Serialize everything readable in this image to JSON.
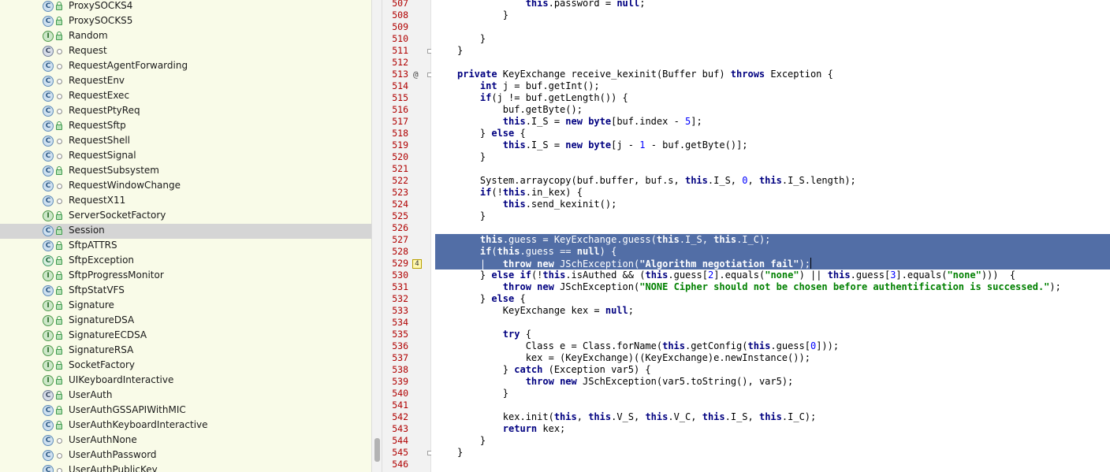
{
  "project_tree": {
    "items": [
      {
        "label": "ProxySOCKS4",
        "kind": "C",
        "vis": "lock"
      },
      {
        "label": "ProxySOCKS5",
        "kind": "C",
        "vis": "lock"
      },
      {
        "label": "Random",
        "kind": "I",
        "vis": "lock"
      },
      {
        "label": "Request",
        "kind": "A",
        "vis": "dot"
      },
      {
        "label": "RequestAgentForwarding",
        "kind": "C",
        "vis": "dot"
      },
      {
        "label": "RequestEnv",
        "kind": "C",
        "vis": "dot"
      },
      {
        "label": "RequestExec",
        "kind": "C",
        "vis": "dot"
      },
      {
        "label": "RequestPtyReq",
        "kind": "C",
        "vis": "dot"
      },
      {
        "label": "RequestSftp",
        "kind": "C",
        "vis": "lock"
      },
      {
        "label": "RequestShell",
        "kind": "C",
        "vis": "dot"
      },
      {
        "label": "RequestSignal",
        "kind": "C",
        "vis": "dot"
      },
      {
        "label": "RequestSubsystem",
        "kind": "C",
        "vis": "lock"
      },
      {
        "label": "RequestWindowChange",
        "kind": "C",
        "vis": "dot"
      },
      {
        "label": "RequestX11",
        "kind": "C",
        "vis": "dot"
      },
      {
        "label": "ServerSocketFactory",
        "kind": "I",
        "vis": "lock"
      },
      {
        "label": "Session",
        "kind": "C",
        "vis": "lock",
        "selected": true
      },
      {
        "label": "SftpATTRS",
        "kind": "C",
        "vis": "lock"
      },
      {
        "label": "SftpException",
        "kind": "E",
        "vis": "lock"
      },
      {
        "label": "SftpProgressMonitor",
        "kind": "I",
        "vis": "lock"
      },
      {
        "label": "SftpStatVFS",
        "kind": "C",
        "vis": "lock"
      },
      {
        "label": "Signature",
        "kind": "I",
        "vis": "lock"
      },
      {
        "label": "SignatureDSA",
        "kind": "I",
        "vis": "lock"
      },
      {
        "label": "SignatureECDSA",
        "kind": "I",
        "vis": "lock"
      },
      {
        "label": "SignatureRSA",
        "kind": "I",
        "vis": "lock"
      },
      {
        "label": "SocketFactory",
        "kind": "I",
        "vis": "lock"
      },
      {
        "label": "UIKeyboardInteractive",
        "kind": "I",
        "vis": "lock"
      },
      {
        "label": "UserAuth",
        "kind": "A",
        "vis": "lock"
      },
      {
        "label": "UserAuthGSSAPIWithMIC",
        "kind": "C",
        "vis": "lock"
      },
      {
        "label": "UserAuthKeyboardInteractive",
        "kind": "C",
        "vis": "lock"
      },
      {
        "label": "UserAuthNone",
        "kind": "C",
        "vis": "dot"
      },
      {
        "label": "UserAuthPassword",
        "kind": "C",
        "vis": "dot"
      },
      {
        "label": "UserAuthPublicKey",
        "kind": "C",
        "vis": "dot"
      }
    ]
  },
  "editor": {
    "annotation_badge": "4",
    "override_marker": "@",
    "lines": [
      {
        "n": "507",
        "code": [
          [
            "",
            "            "
          ],
          [
            "kw",
            "this"
          ],
          [
            "",
            ".password = "
          ],
          [
            "kw",
            "null"
          ],
          [
            "",
            ";"
          ]
        ]
      },
      {
        "n": "508",
        "code": [
          [
            "",
            "        }"
          ]
        ]
      },
      {
        "n": "509",
        "code": [
          [
            "",
            ""
          ]
        ]
      },
      {
        "n": "510",
        "code": [
          [
            "",
            "    }"
          ]
        ]
      },
      {
        "n": "511",
        "code": [
          [
            "",
            "}"
          ]
        ],
        "fold": true
      },
      {
        "n": "512",
        "code": [
          [
            "",
            ""
          ]
        ]
      },
      {
        "n": "513",
        "code": [
          [
            "kw",
            "private"
          ],
          [
            "",
            " KeyExchange receive_kexinit(Buffer buf) "
          ],
          [
            "kw",
            "throws"
          ],
          [
            "",
            " Exception {"
          ]
        ],
        "fold": true,
        "override": true
      },
      {
        "n": "514",
        "code": [
          [
            "",
            "    "
          ],
          [
            "kw",
            "int"
          ],
          [
            "",
            " j = buf.getInt();"
          ]
        ]
      },
      {
        "n": "515",
        "code": [
          [
            "",
            "    "
          ],
          [
            "kw",
            "if"
          ],
          [
            "",
            "(j != buf.getLength()) {"
          ]
        ]
      },
      {
        "n": "516",
        "code": [
          [
            "",
            "        buf.getByte();"
          ]
        ]
      },
      {
        "n": "517",
        "code": [
          [
            "",
            "        "
          ],
          [
            "kw",
            "this"
          ],
          [
            "",
            ".I_S = "
          ],
          [
            "kw",
            "new"
          ],
          [
            "",
            " "
          ],
          [
            "kw",
            "byte"
          ],
          [
            "",
            "[buf.index - "
          ],
          [
            "num",
            "5"
          ],
          [
            "",
            "];"
          ]
        ]
      },
      {
        "n": "518",
        "code": [
          [
            "",
            "    } "
          ],
          [
            "kw",
            "else"
          ],
          [
            "",
            " {"
          ]
        ]
      },
      {
        "n": "519",
        "code": [
          [
            "",
            "        "
          ],
          [
            "kw",
            "this"
          ],
          [
            "",
            ".I_S = "
          ],
          [
            "kw",
            "new"
          ],
          [
            "",
            " "
          ],
          [
            "kw",
            "byte"
          ],
          [
            "",
            "[j - "
          ],
          [
            "num",
            "1"
          ],
          [
            "",
            " - buf.getByte()];"
          ]
        ]
      },
      {
        "n": "520",
        "code": [
          [
            "",
            "    }"
          ]
        ]
      },
      {
        "n": "521",
        "code": [
          [
            "",
            ""
          ]
        ]
      },
      {
        "n": "522",
        "code": [
          [
            "",
            "    System.arraycopy(buf.buffer, buf.s, "
          ],
          [
            "kw",
            "this"
          ],
          [
            "",
            ".I_S, "
          ],
          [
            "num",
            "0"
          ],
          [
            "",
            ", "
          ],
          [
            "kw",
            "this"
          ],
          [
            "",
            ".I_S.length);"
          ]
        ]
      },
      {
        "n": "523",
        "code": [
          [
            "",
            "    "
          ],
          [
            "kw",
            "if"
          ],
          [
            "",
            "(!"
          ],
          [
            "kw",
            "this"
          ],
          [
            "",
            ".in_kex) {"
          ]
        ]
      },
      {
        "n": "524",
        "code": [
          [
            "",
            "        "
          ],
          [
            "kw",
            "this"
          ],
          [
            "",
            ".send_kexinit();"
          ]
        ]
      },
      {
        "n": "525",
        "code": [
          [
            "",
            "    }"
          ]
        ]
      },
      {
        "n": "526",
        "code": [
          [
            "",
            ""
          ]
        ]
      },
      {
        "n": "527",
        "code": [
          [
            "",
            "    "
          ],
          [
            "kw",
            "this"
          ],
          [
            "",
            ".guess = KeyExchange.guess("
          ],
          [
            "kw",
            "this"
          ],
          [
            "",
            ".I_S, "
          ],
          [
            "kw",
            "this"
          ],
          [
            "",
            ".I_C);"
          ]
        ],
        "sel": true
      },
      {
        "n": "528",
        "code": [
          [
            "",
            "    "
          ],
          [
            "kw",
            "if"
          ],
          [
            "",
            "("
          ],
          [
            "kw",
            "this"
          ],
          [
            "",
            ".guess == "
          ],
          [
            "kw",
            "null"
          ],
          [
            "",
            ") {"
          ]
        ],
        "sel": true
      },
      {
        "n": "529",
        "code": [
          [
            "",
            "    |   "
          ],
          [
            "kw",
            "throw"
          ],
          [
            "",
            " "
          ],
          [
            "kw",
            "new"
          ],
          [
            "",
            " JSchException("
          ],
          [
            "str",
            "\"Algorithm negotiation fail\""
          ],
          [
            "",
            ");"
          ]
        ],
        "sel": true,
        "badge": true,
        "caret": true
      },
      {
        "n": "530",
        "code": [
          [
            "",
            "    } "
          ],
          [
            "kw",
            "else"
          ],
          [
            "",
            " "
          ],
          [
            "kw",
            "if"
          ],
          [
            "",
            "(!"
          ],
          [
            "kw",
            "this"
          ],
          [
            "",
            ".isAuthed && ("
          ],
          [
            "kw",
            "this"
          ],
          [
            "",
            ".guess["
          ],
          [
            "num",
            "2"
          ],
          [
            "",
            "].equals("
          ],
          [
            "str",
            "\"none\""
          ],
          [
            "",
            ") || "
          ],
          [
            "kw",
            "this"
          ],
          [
            "",
            ".guess["
          ],
          [
            "num",
            "3"
          ],
          [
            "",
            "].equals("
          ],
          [
            "str",
            "\"none\""
          ],
          [
            "",
            ")))  {"
          ]
        ]
      },
      {
        "n": "531",
        "code": [
          [
            "",
            "        "
          ],
          [
            "kw",
            "throw"
          ],
          [
            "",
            " "
          ],
          [
            "kw",
            "new"
          ],
          [
            "",
            " JSchException("
          ],
          [
            "str",
            "\"NONE Cipher should not be chosen before authentification is successed.\""
          ],
          [
            "",
            ");"
          ]
        ]
      },
      {
        "n": "532",
        "code": [
          [
            "",
            "    } "
          ],
          [
            "kw",
            "else"
          ],
          [
            "",
            " {"
          ]
        ]
      },
      {
        "n": "533",
        "code": [
          [
            "",
            "        KeyExchange kex = "
          ],
          [
            "kw",
            "null"
          ],
          [
            "",
            ";"
          ]
        ]
      },
      {
        "n": "534",
        "code": [
          [
            "",
            ""
          ]
        ]
      },
      {
        "n": "535",
        "code": [
          [
            "",
            "        "
          ],
          [
            "kw",
            "try"
          ],
          [
            "",
            " {"
          ]
        ]
      },
      {
        "n": "536",
        "code": [
          [
            "",
            "            Class e = Class.forName("
          ],
          [
            "kw",
            "this"
          ],
          [
            "",
            ".getConfig("
          ],
          [
            "kw",
            "this"
          ],
          [
            "",
            ".guess["
          ],
          [
            "num",
            "0"
          ],
          [
            "",
            "]));"
          ]
        ]
      },
      {
        "n": "537",
        "code": [
          [
            "",
            "            kex = (KeyExchange)((KeyExchange)e.newInstance());"
          ]
        ]
      },
      {
        "n": "538",
        "code": [
          [
            "",
            "        } "
          ],
          [
            "kw",
            "catch"
          ],
          [
            "",
            " (Exception var5) {"
          ]
        ]
      },
      {
        "n": "539",
        "code": [
          [
            "",
            "            "
          ],
          [
            "kw",
            "throw"
          ],
          [
            "",
            " "
          ],
          [
            "kw",
            "new"
          ],
          [
            "",
            " JSchException(var5.toString(), var5);"
          ]
        ]
      },
      {
        "n": "540",
        "code": [
          [
            "",
            "        }"
          ]
        ]
      },
      {
        "n": "541",
        "code": [
          [
            "",
            ""
          ]
        ]
      },
      {
        "n": "542",
        "code": [
          [
            "",
            "        kex.init("
          ],
          [
            "kw",
            "this"
          ],
          [
            "",
            ", "
          ],
          [
            "kw",
            "this"
          ],
          [
            "",
            ".V_S, "
          ],
          [
            "kw",
            "this"
          ],
          [
            "",
            ".V_C, "
          ],
          [
            "kw",
            "this"
          ],
          [
            "",
            ".I_S, "
          ],
          [
            "kw",
            "this"
          ],
          [
            "",
            ".I_C);"
          ]
        ]
      },
      {
        "n": "543",
        "code": [
          [
            "",
            "        "
          ],
          [
            "kw",
            "return"
          ],
          [
            "",
            " kex;"
          ]
        ]
      },
      {
        "n": "544",
        "code": [
          [
            "",
            "    }"
          ]
        ]
      },
      {
        "n": "545",
        "code": [
          [
            "",
            "}"
          ]
        ],
        "fold": true
      },
      {
        "n": "546",
        "code": [
          [
            "",
            ""
          ]
        ]
      }
    ]
  }
}
